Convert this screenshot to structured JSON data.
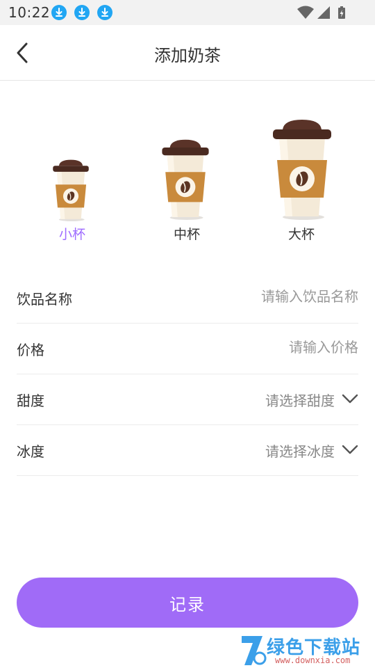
{
  "status_bar": {
    "time": "10:22",
    "notification_icons": [
      "download-icon",
      "download-icon",
      "download-icon"
    ],
    "system_icons": [
      "wifi-icon",
      "signal-icon",
      "battery-charging-icon"
    ]
  },
  "header": {
    "title": "添加奶茶",
    "back_icon": "chevron-left-icon"
  },
  "cup_sizes": {
    "options": [
      {
        "label": "小杯",
        "selected": true
      },
      {
        "label": "中杯",
        "selected": false
      },
      {
        "label": "大杯",
        "selected": false
      }
    ],
    "selected_color": "#9e6bff"
  },
  "form": {
    "name": {
      "label": "饮品名称",
      "placeholder": "请输入饮品名称"
    },
    "price": {
      "label": "价格",
      "placeholder": "请输入价格"
    },
    "sweetness": {
      "label": "甜度",
      "placeholder": "请选择甜度"
    },
    "ice": {
      "label": "冰度",
      "placeholder": "请选择冰度"
    }
  },
  "submit": {
    "label": "记录",
    "color": "#a06bf7"
  },
  "watermark": {
    "text": "绿色下载站",
    "url": "www.downxia.com"
  }
}
